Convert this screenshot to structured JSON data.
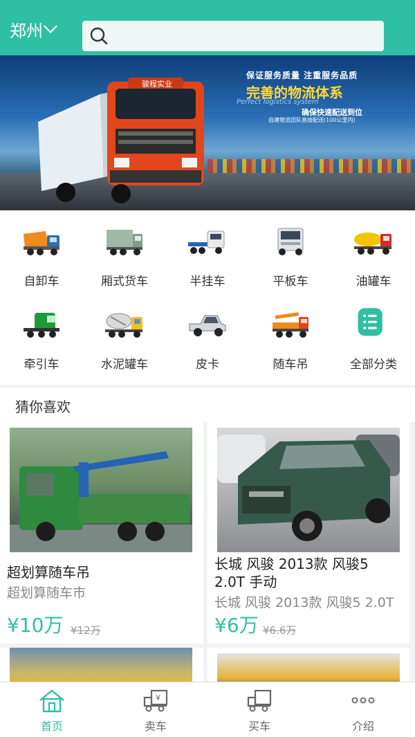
{
  "header": {
    "city": "郑州",
    "search_placeholder": ""
  },
  "banner": {
    "line1": "保证服务质量 注重服务品质",
    "line2": "完善的物流体系",
    "line3": "Perfect logistics system",
    "line4": "确保快速配送到位",
    "line5": "自建物流团队直接配送(100公里内)",
    "truck_brand": "骏程实业"
  },
  "categories": [
    {
      "label": "自卸车",
      "icon": "dump-truck-icon"
    },
    {
      "label": "厢式货车",
      "icon": "box-truck-icon"
    },
    {
      "label": "半挂车",
      "icon": "semi-trailer-icon"
    },
    {
      "label": "平板车",
      "icon": "flatbed-truck-icon"
    },
    {
      "label": "油罐车",
      "icon": "tanker-truck-icon"
    },
    {
      "label": "牵引车",
      "icon": "tractor-truck-icon"
    },
    {
      "label": "水泥罐车",
      "icon": "cement-mixer-icon"
    },
    {
      "label": "皮卡",
      "icon": "pickup-icon"
    },
    {
      "label": "随车吊",
      "icon": "crane-truck-icon"
    },
    {
      "label": "全部分类",
      "icon": "list-icon"
    }
  ],
  "section": {
    "title": "猜你喜欢"
  },
  "products": [
    {
      "title": "超划算随车吊",
      "subtitle": "超划算随车市",
      "price": "¥10万",
      "old_price": "¥12万"
    },
    {
      "title": "长城 风骏 2013款 风骏5 2.0T 手动",
      "subtitle": "长城 风骏 2013款 风骏5 2.0T",
      "price": "¥6万",
      "old_price": "¥6.6万"
    }
  ],
  "nav": [
    {
      "label": "首页",
      "icon": "home-icon",
      "active": true
    },
    {
      "label": "卖车",
      "icon": "sell-truck-icon",
      "active": false
    },
    {
      "label": "买车",
      "icon": "buy-truck-icon",
      "active": false
    },
    {
      "label": "介绍",
      "icon": "more-icon",
      "active": false
    }
  ],
  "colors": {
    "accent": "#2fbfa3",
    "price": "#2fbfa3",
    "background": "#f2f2f2"
  }
}
